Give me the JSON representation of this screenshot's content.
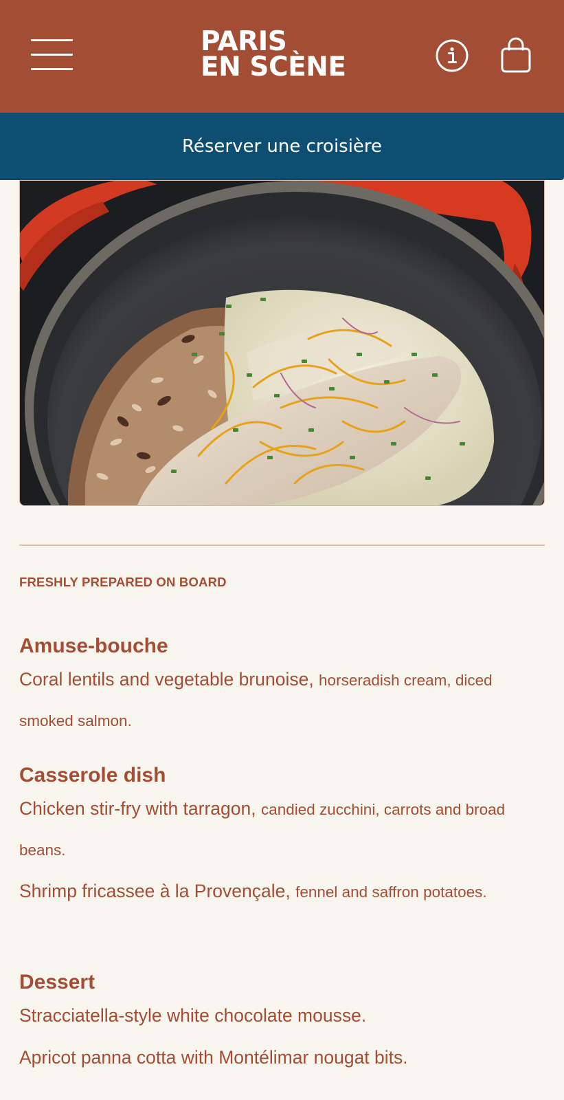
{
  "header": {
    "logo_line1": "PARIS",
    "logo_line2": "EN SCÈNE",
    "menu_icon": "hamburger-menu-icon",
    "info_icon": "info-icon",
    "bag_icon": "shopping-bag-icon",
    "background_color": "#A34D35"
  },
  "booking": {
    "label": "Réserver une croisière",
    "background_color": "#0D4E72"
  },
  "hero": {
    "alt": "Fish fillet with rice in a red cast-iron casserole"
  },
  "menu": {
    "eyebrow": "FRESHLY PREPARED ON BOARD",
    "courses": [
      {
        "title": "Amuse-bouche",
        "dishes": [
          {
            "main": "Coral lentils and vegetable brunoise, ",
            "detail": "horseradish cream, diced smoked salmon."
          }
        ]
      },
      {
        "title": "Casserole dish",
        "dishes": [
          {
            "main": "Chicken stir-fry with tarragon, ",
            "detail": "candied zucchini, carrots and broad beans."
          },
          {
            "main": "Shrimp fricassee à la Provençale, ",
            "detail": "fennel and saffron potatoes."
          }
        ]
      },
      {
        "title": "Dessert",
        "dishes": [
          {
            "main": "Stracciatella-style white chocolate mousse.",
            "detail": ""
          },
          {
            "main": "Apricot panna cotta with Montélimar nougat bits.",
            "detail": ""
          }
        ]
      }
    ]
  },
  "colors": {
    "page_background": "#F8F4EE",
    "accent": "#A34D35",
    "booking_bar": "#0D4E72"
  }
}
